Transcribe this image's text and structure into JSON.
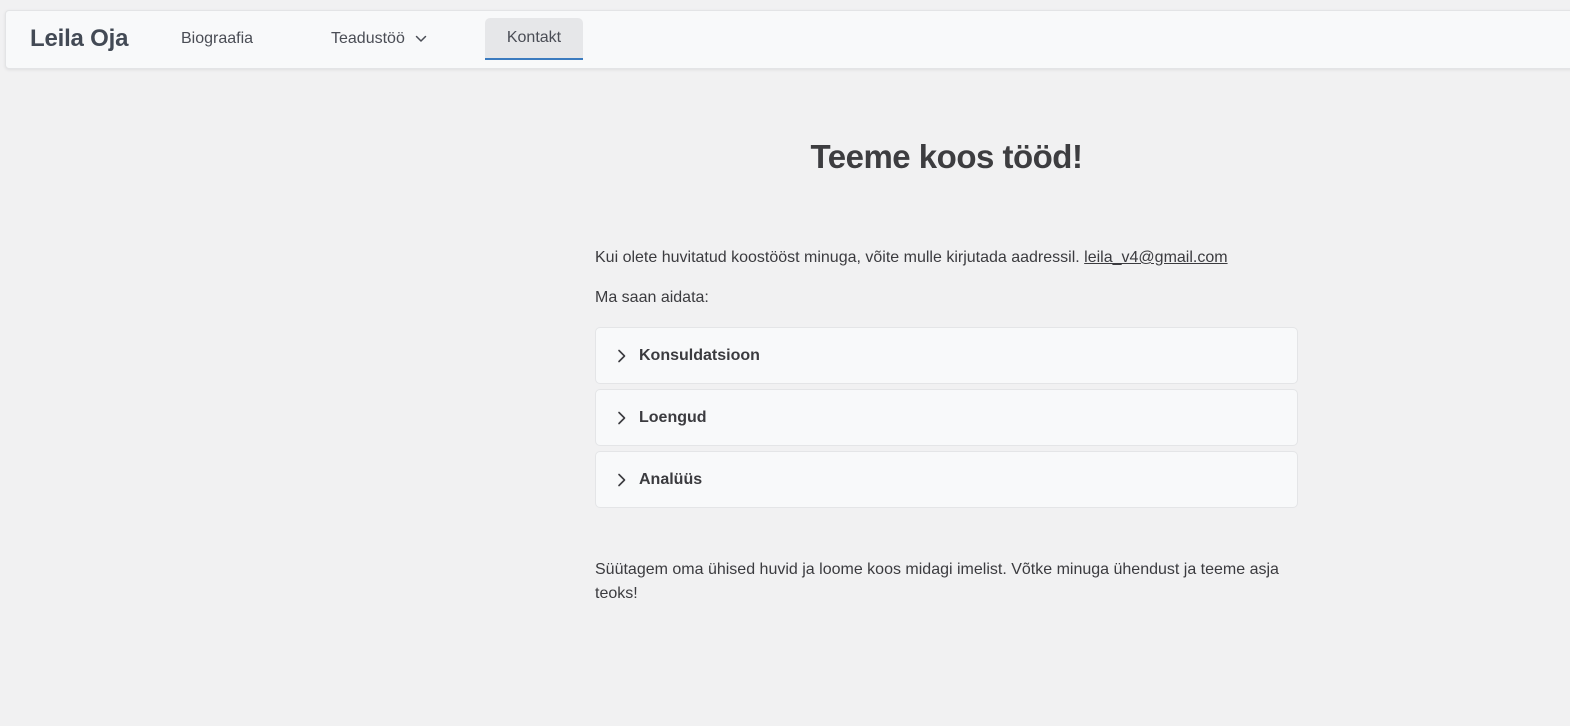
{
  "nav": {
    "brand": "Leila Oja",
    "items": [
      {
        "label": "Biograafia"
      },
      {
        "label": "Teadustöö"
      },
      {
        "label": "Kontakt"
      }
    ]
  },
  "main": {
    "title": "Teeme koos tööd!",
    "intro_text": "Kui olete huvitatud koostööst minuga, võite mulle kirjutada aadressil.",
    "email": "leila_v4@gmail.com",
    "help_label": "Ma saan aidata:",
    "accordion": [
      {
        "title": "Konsuldatsioon"
      },
      {
        "title": "Loengud"
      },
      {
        "title": "Analüüs"
      }
    ],
    "closing": "Süütagem oma ühised huvid ja loome koos midagi imelist. Võtke minuga ühendust ja teeme asja teoks!"
  },
  "colors": {
    "background": "#f1f1f2",
    "navbar": "#f8f9fa",
    "active_underline": "#3b7bbf",
    "text": "#3b3b3f"
  },
  "icons": {
    "dropdown": "chevron-down-icon",
    "accordion": "chevron-right-icon"
  }
}
